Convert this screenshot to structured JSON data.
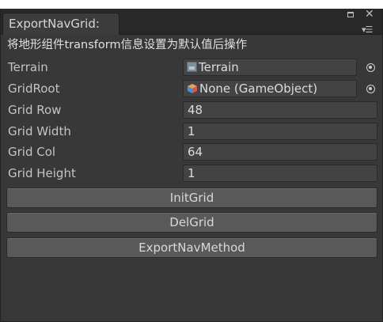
{
  "window": {
    "tab_title": "ExportNavGrid:",
    "description": "将地形组件transform信息设置为默认值后操作"
  },
  "fields": {
    "terrain": {
      "label": "Terrain",
      "value": "Terrain",
      "icon": "terrain-icon"
    },
    "grid_root": {
      "label": "GridRoot",
      "value": "None (GameObject)",
      "icon": "gameobject-cube-icon"
    },
    "grid_row": {
      "label": "Grid Row",
      "value": "48"
    },
    "grid_width": {
      "label": "Grid Width",
      "value": "1"
    },
    "grid_col": {
      "label": "Grid Col",
      "value": "64"
    },
    "grid_height": {
      "label": "Grid Height",
      "value": "1"
    }
  },
  "buttons": {
    "init_grid": "InitGrid",
    "del_grid": "DelGrid",
    "export_nav_method": "ExportNavMethod"
  },
  "colors": {
    "panel_bg": "#383838",
    "tabbar_bg": "#282828",
    "field_bg": "#434343",
    "button_bg": "#595959",
    "text": "#c4c4c4"
  }
}
